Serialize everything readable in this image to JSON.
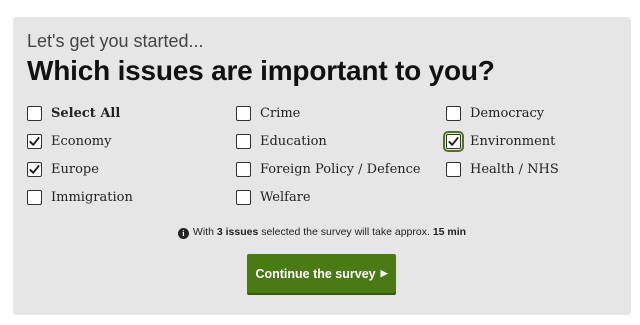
{
  "intro_text": "Let's get you started...",
  "question_title": "Which issues are important to you?",
  "options": [
    {
      "label": "Select All",
      "checked": false,
      "bold": true
    },
    {
      "label": "Crime",
      "checked": false
    },
    {
      "label": "Democracy",
      "checked": false
    },
    {
      "label": "Economy",
      "checked": true
    },
    {
      "label": "Education",
      "checked": false
    },
    {
      "label": "Environment",
      "checked": true,
      "focused": true
    },
    {
      "label": "Europe",
      "checked": true
    },
    {
      "label": "Foreign Policy / Defence",
      "checked": false
    },
    {
      "label": "Health / NHS",
      "checked": false
    },
    {
      "label": "Immigration",
      "checked": false
    },
    {
      "label": "Welfare",
      "checked": false
    }
  ],
  "info": {
    "icon": "info-icon",
    "prefix": "With ",
    "count": "3 issues",
    "middle": " selected the survey will take approx. ",
    "time": "15 min"
  },
  "continue_button": {
    "label": "Continue the survey",
    "arrow": "▶",
    "color": "#4a7a14"
  },
  "colors": {
    "panel_background": "#e6e6e6",
    "accent": "#4a7a14",
    "text": "#222222"
  }
}
